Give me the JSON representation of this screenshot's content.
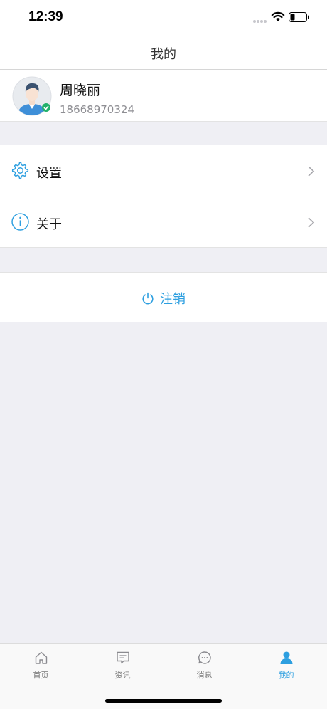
{
  "status_bar": {
    "time": "12:39"
  },
  "nav": {
    "title": "我的"
  },
  "profile": {
    "name": "周晓丽",
    "phone": "18668970324"
  },
  "menu": {
    "items": [
      {
        "label": "设置",
        "icon": "gear-icon"
      },
      {
        "label": "关于",
        "icon": "info-icon"
      }
    ]
  },
  "logout": {
    "label": "注销",
    "icon": "power-icon"
  },
  "tabs": [
    {
      "label": "首页",
      "icon": "home-icon",
      "active": false
    },
    {
      "label": "资讯",
      "icon": "news-icon",
      "active": false
    },
    {
      "label": "消息",
      "icon": "message-icon",
      "active": false
    },
    {
      "label": "我的",
      "icon": "user-icon",
      "active": true
    }
  ],
  "colors": {
    "accent": "#2d9fe0",
    "background": "#efeff4",
    "inactive_tab": "#777777"
  }
}
